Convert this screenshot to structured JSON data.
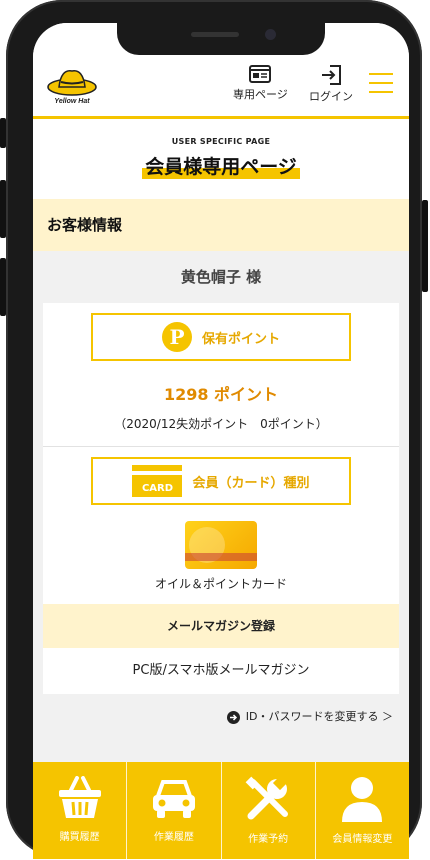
{
  "header": {
    "logo_text": "Yellow Hat",
    "member_page_label": "専用ページ",
    "login_label": "ログイン"
  },
  "page": {
    "subtitle": "USER SPECIFIC PAGE",
    "title": "会員様専用ページ"
  },
  "customer": {
    "section_title": "お客様情報",
    "name": "黄色帽子 様"
  },
  "points": {
    "box_label": "保有ポイント",
    "amount": "1298 ポイント",
    "expire_note": "（2020/12失効ポイント　0ポイント）"
  },
  "membership": {
    "box_label": "会員（カード）種別",
    "card_icon_text": "CARD",
    "card_name": "オイル＆ポイントカード"
  },
  "mail": {
    "section_title": "メールマガジン登録",
    "item": "PC版/スマホ版メールマガジン"
  },
  "change_link": "ID・パスワードを変更する ＞",
  "bottom_nav": [
    {
      "label": "購買履歴",
      "icon": "basket-icon"
    },
    {
      "label": "作業履歴",
      "icon": "car-icon"
    },
    {
      "label": "作業予約",
      "icon": "tools-icon"
    },
    {
      "label": "会員情報変更",
      "icon": "user-icon"
    }
  ],
  "colors": {
    "accent": "#f5c400",
    "highlight_bg": "#fff3cc",
    "points_text": "#e08a00"
  }
}
